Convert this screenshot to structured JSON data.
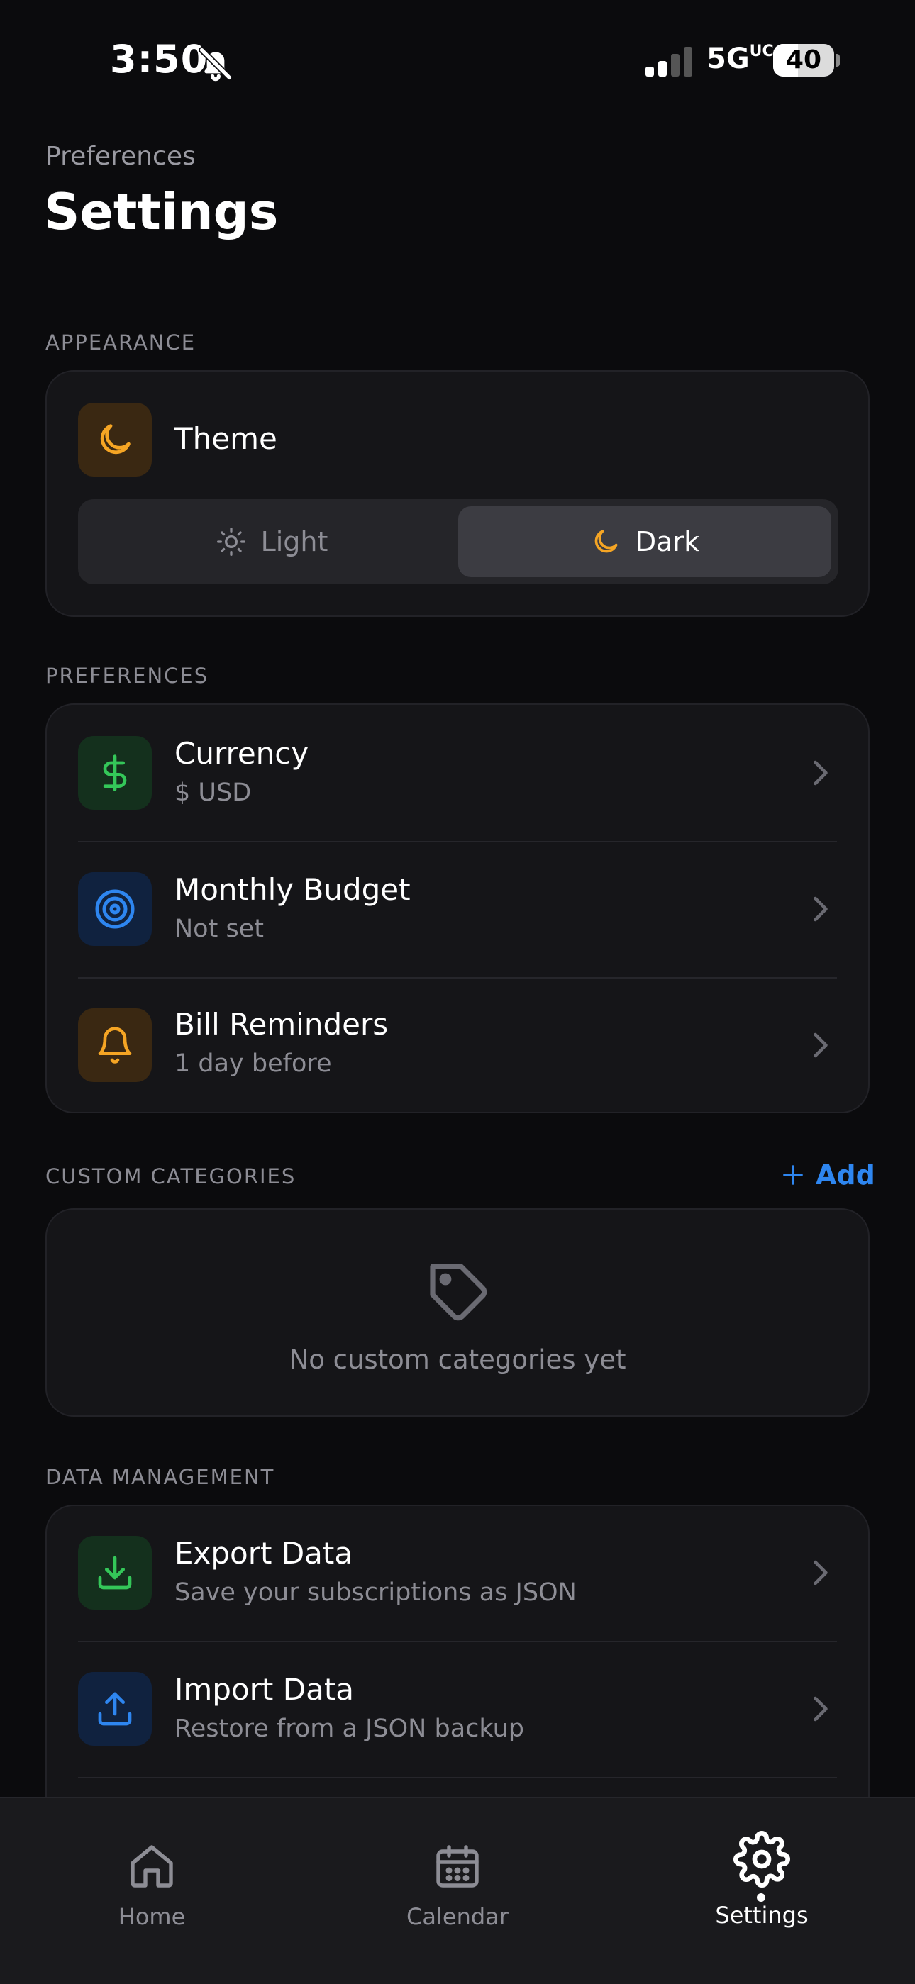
{
  "status_bar": {
    "time": "3:50",
    "network": "5G",
    "network_suffix": "UC",
    "battery": "40"
  },
  "header": {
    "eyebrow": "Preferences",
    "title": "Settings"
  },
  "appearance": {
    "section_label": "APPEARANCE",
    "theme_label": "Theme",
    "options": {
      "light": "Light",
      "dark": "Dark"
    },
    "selected": "Dark"
  },
  "preferences": {
    "section_label": "PREFERENCES",
    "items": [
      {
        "title": "Currency",
        "subtitle": "$ USD"
      },
      {
        "title": "Monthly Budget",
        "subtitle": "Not set"
      },
      {
        "title": "Bill Reminders",
        "subtitle": "1 day before"
      }
    ]
  },
  "custom_categories": {
    "section_label": "CUSTOM CATEGORIES",
    "add_label": "Add",
    "empty_text": "No custom categories yet"
  },
  "data_management": {
    "section_label": "DATA MANAGEMENT",
    "items": [
      {
        "title": "Export Data",
        "subtitle": "Save your subscriptions as JSON"
      },
      {
        "title": "Import Data",
        "subtitle": "Restore from a JSON backup"
      }
    ]
  },
  "tabbar": {
    "tabs": [
      {
        "label": "Home",
        "icon": "home-icon"
      },
      {
        "label": "Calendar",
        "icon": "calendar-icon"
      },
      {
        "label": "Settings",
        "icon": "gear-icon"
      }
    ],
    "active": "Settings"
  },
  "colors": {
    "accent_blue": "#2e86f0",
    "accent_orange": "#f5a524",
    "accent_green": "#34c759",
    "background": "#0b0b0d",
    "card": "#151518"
  }
}
